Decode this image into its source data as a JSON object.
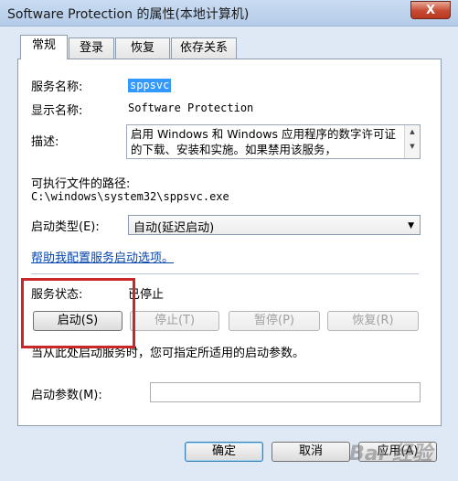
{
  "window": {
    "title": "Software Protection 的属性(本地计算机)",
    "close_label": "X"
  },
  "tabs": [
    "常规",
    "登录",
    "恢复",
    "依存关系"
  ],
  "fields": {
    "service_name_label": "服务名称:",
    "service_name_value": "sppsvc",
    "display_name_label": "显示名称:",
    "display_name_value": "Software Protection",
    "description_label": "描述:",
    "description_value": "启用 Windows 和 Windows 应用程序的数字许可证的下载、安装和实施。如果禁用该服务，",
    "exe_path_label": "可执行文件的路径:",
    "exe_path_value": "C:\\windows\\system32\\sppsvc.exe",
    "startup_type_label": "启动类型(E):",
    "startup_type_value": "自动(延迟启动)",
    "help_link": "帮助我配置服务启动选项。"
  },
  "status": {
    "label": "服务状态:",
    "value": "已停止",
    "buttons": [
      {
        "label": "启动(S)",
        "enabled": true
      },
      {
        "label": "停止(T)",
        "enabled": false
      },
      {
        "label": "暂停(P)",
        "enabled": false
      },
      {
        "label": "恢复(R)",
        "enabled": false
      }
    ],
    "hint": "当从此处启动服务时，您可指定所适用的启动参数。",
    "param_label": "启动参数(M):",
    "param_value": ""
  },
  "footer": {
    "ok": "确定",
    "cancel": "取消",
    "apply": "应用(A)"
  },
  "watermark": "Bai 经验",
  "colors": {
    "highlight": "#3399ff",
    "annotation": "#c8282a",
    "link": "#0645ad"
  }
}
